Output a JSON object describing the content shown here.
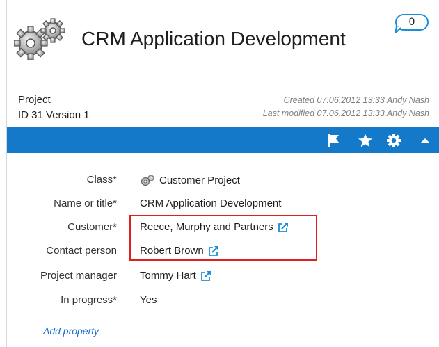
{
  "header": {
    "title": "CRM Application Development",
    "icon": "gears-icon"
  },
  "comments": {
    "count": "0"
  },
  "meta": {
    "type": "Project",
    "id_version": "ID 31  Version 1",
    "created": "Created 07.06.2012 13:33 Andy Nash",
    "modified": "Last modified 07.06.2012 13:33 Andy Nash"
  },
  "toolbar": {
    "icons": [
      "flag-icon",
      "star-icon",
      "gear-icon",
      "collapse-icon"
    ],
    "color": "#1479c9"
  },
  "properties": [
    {
      "label": "Class*",
      "value": "Customer Project"
    },
    {
      "label": "Name or title*",
      "value": "CRM Application Development"
    },
    {
      "label": "Customer*",
      "value": "Reece, Murphy and Partners"
    },
    {
      "label": "Contact person",
      "value": "Robert Brown"
    },
    {
      "label": "Project manager",
      "value": "Tommy Hart"
    },
    {
      "label": "In progress*",
      "value": "Yes"
    }
  ],
  "add_property": "Add property",
  "colors": {
    "link": "#1a6fd0",
    "highlight": "#e0201f",
    "accent": "#1a8fd6"
  }
}
